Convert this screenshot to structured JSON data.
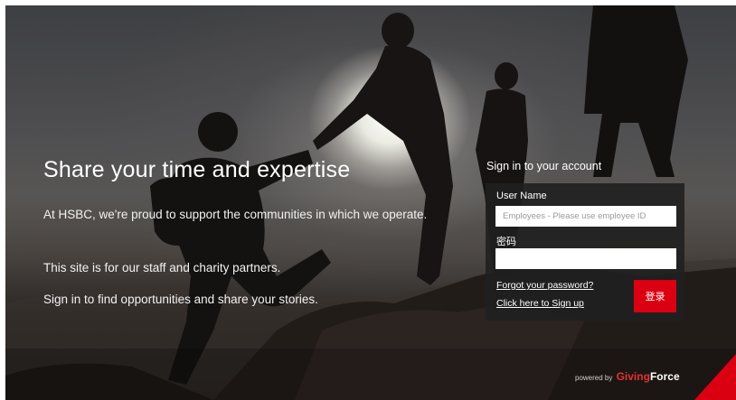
{
  "hero": {
    "headline": "Share your time and expertise",
    "paragraph1": "At HSBC, we're proud to support the communities in which we operate.",
    "paragraph2": "This site is for our staff and charity partners.",
    "paragraph3": "Sign in to find opportunities and share your stories."
  },
  "signin": {
    "title": "Sign in to your account",
    "username_label": "User Name",
    "username_placeholder": "Employees - Please use employee ID",
    "username_value": "",
    "password_label": "密码",
    "password_value": "",
    "forgot_link": "Forgot your password?",
    "signup_link": "Click here to Sign up",
    "login_button": "登录"
  },
  "footer": {
    "powered_by": "powered by",
    "brand_a": "Giving",
    "brand_b": "Force"
  },
  "colors": {
    "accent": "#db0011",
    "brand": "#e7312e",
    "panel": "#202020"
  },
  "icons": {
    "corner": "hsbc-corner-triangle"
  }
}
